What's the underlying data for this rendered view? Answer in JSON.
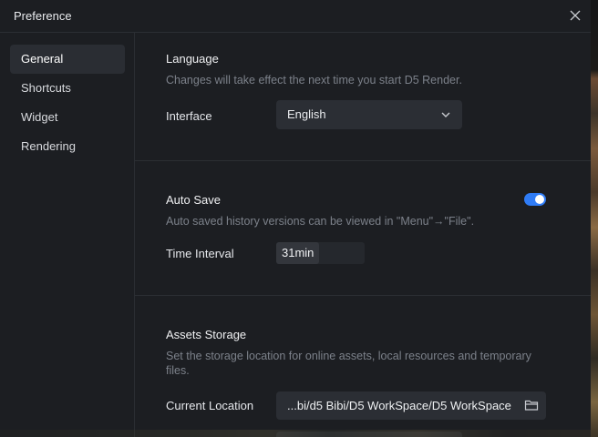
{
  "window": {
    "title": "Preference"
  },
  "sidebar": {
    "items": [
      {
        "label": "General",
        "active": true
      },
      {
        "label": "Shortcuts",
        "active": false
      },
      {
        "label": "Widget",
        "active": false
      },
      {
        "label": "Rendering",
        "active": false
      }
    ]
  },
  "language": {
    "title": "Language",
    "description": "Changes will take effect the next time you start D5 Render.",
    "interface_label": "Interface",
    "interface_value": "English"
  },
  "auto_save": {
    "title": "Auto Save",
    "enabled": true,
    "description": "Auto saved history versions can be viewed in \"Menu\"→\"File\".",
    "interval_label": "Time Interval",
    "interval_value": "31min"
  },
  "assets_storage": {
    "title": "Assets Storage",
    "description_line1": "Set the storage location for online assets, local resources and temporary",
    "description_line2": "files.",
    "location_label": "Current Location",
    "location_value": "...bi/d5 Bibi/D5 WorkSpace/D5 WorkSpace"
  },
  "colors": {
    "background": "#1c1e22",
    "accent": "#2f7cf6",
    "muted_text": "#7c818a",
    "field": "#2b2e34"
  },
  "icons": {
    "close": "close-icon",
    "dropdown": "chevron-down-icon",
    "folder": "folder-icon"
  }
}
